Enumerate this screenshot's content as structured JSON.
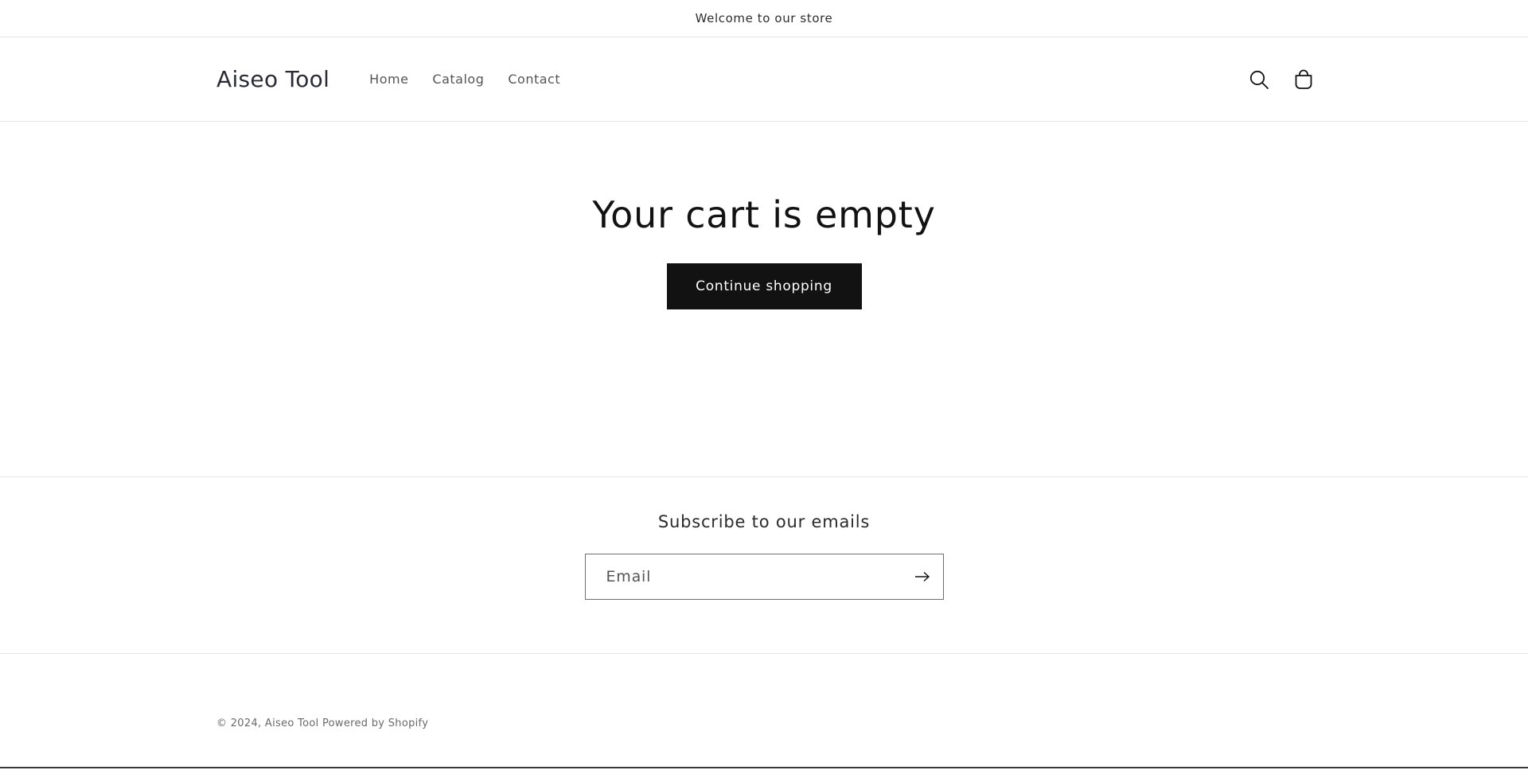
{
  "announcement": {
    "text": "Welcome to our store"
  },
  "header": {
    "logo": "Aiseo Tool",
    "nav": [
      {
        "label": "Home"
      },
      {
        "label": "Catalog"
      },
      {
        "label": "Contact"
      }
    ],
    "icons": {
      "search": "search-icon",
      "cart": "cart-icon"
    }
  },
  "cart": {
    "title": "Your cart is empty",
    "continue_label": "Continue shopping"
  },
  "newsletter": {
    "title": "Subscribe to our emails",
    "email_placeholder": "Email",
    "email_value": ""
  },
  "footer": {
    "copyright_prefix": "© 2024,",
    "store_link": "Aiseo Tool",
    "powered_by": "Powered by Shopify"
  },
  "colors": {
    "primary": "#121212",
    "text_muted": "#555555",
    "border": "#e6e6e6"
  }
}
